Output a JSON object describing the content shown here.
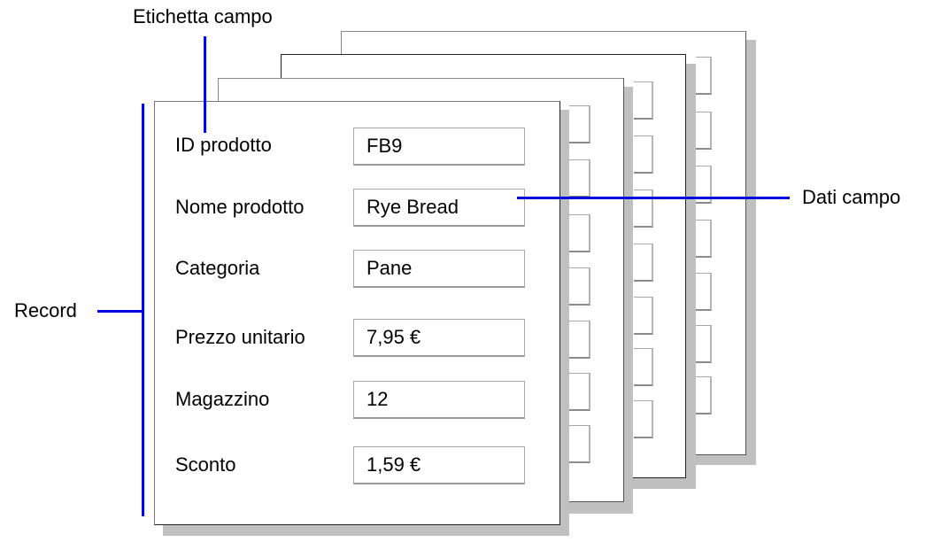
{
  "diagram": {
    "callouts": {
      "field_label": "Etichetta campo",
      "field_data": "Dati campo",
      "record": "Record"
    },
    "record_fields": [
      {
        "label": "ID prodotto",
        "value": "FB9"
      },
      {
        "label": "Nome prodotto",
        "value": "Rye Bread"
      },
      {
        "label": "Categoria",
        "value": "Pane"
      },
      {
        "label": "Prezzo unitario",
        "value": "7,95 €"
      },
      {
        "label": "Magazzino",
        "value": "12"
      },
      {
        "label": "Sconto",
        "value": "1,59 €"
      }
    ],
    "stacked_record_count": 4,
    "colors": {
      "callout_line": "#0000e0",
      "shadow": "#c0c0c0",
      "card_border": "#555555"
    }
  }
}
